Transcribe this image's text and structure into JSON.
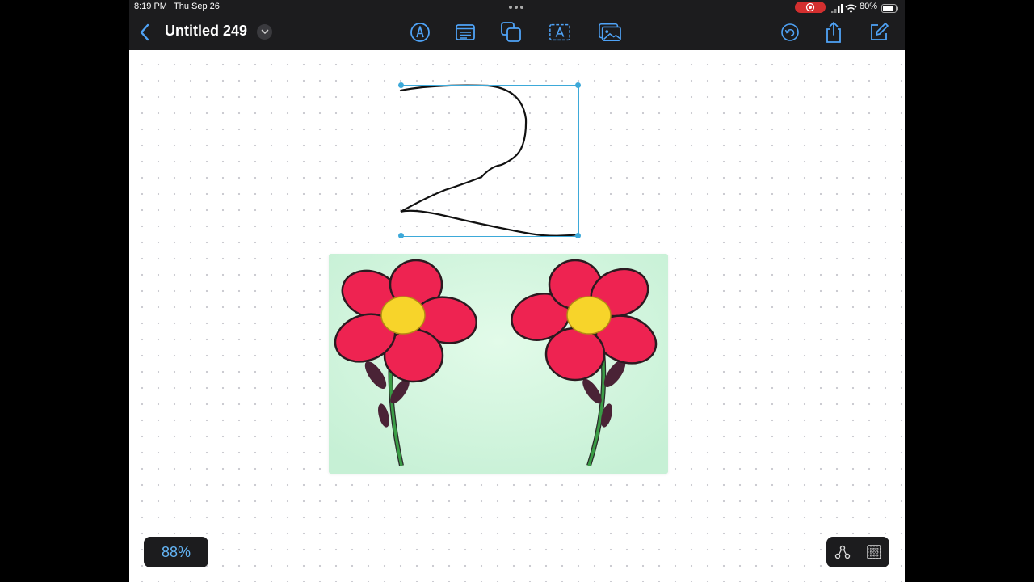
{
  "status_bar": {
    "time": "8:19 PM",
    "date": "Thu Sep 26",
    "battery": "80%",
    "icons": [
      "multitask-dots-icon",
      "screen-record-icon",
      "cellular-signal-icon",
      "wifi-icon",
      "battery-icon"
    ]
  },
  "toolbar": {
    "title": "Untitled 249",
    "icons": [
      "back-chevron-icon",
      "title-dropdown-icon",
      "pen-tool-icon",
      "text-box-icon",
      "shapes-icon",
      "text-tool-icon",
      "image-insert-icon",
      "undo-icon",
      "share-icon",
      "compose-icon"
    ]
  },
  "canvas": {
    "background": "dot-grid",
    "drawn_number": "2",
    "image_description": "two red flowers on mint green",
    "image_colors": {
      "background": "#cdf5dc",
      "petal": "#ee2351",
      "center": "#f7d42a",
      "stem": "#3a9c46",
      "leaf": "#4a2336"
    },
    "selection_color": "#3da9d9"
  },
  "zoom": {
    "label": "88%"
  },
  "bottom_tools": {
    "icons": [
      "nodes-icon",
      "grid-icon"
    ]
  }
}
